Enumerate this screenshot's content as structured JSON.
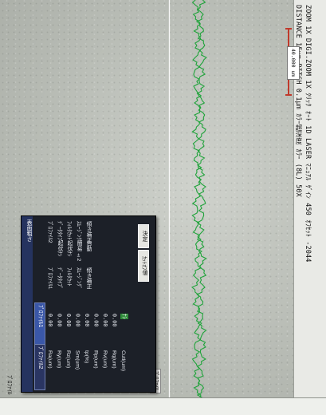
{
  "header": {
    "line1": "ZOOM 1X DIGI.ZOOM 1X ｸﾘｯｸ ｵｰﾄ   1D LASER ﾏﾆｭｱﾙ ｹﾞｲﾝ 450 ｵﾌｾｯﾄ -2044",
    "line2": "DISTANCE 15μm PITCH 0.1μm ｶﾗｰ超深度 ｶﾗｰ (8L) 50X"
  },
  "scale_label": "40.000 um",
  "status": {
    "cursor_label": "ﾌﾟﾛﾌｧｲﾙ",
    "bottom_label": "ﾌﾟﾛﾌｧｲﾙ"
  },
  "panel": {
    "title": "表面粗さ",
    "tabs": [
      "ﾌﾟﾛﾌｧｲﾙ1",
      "ﾌﾟﾛﾌｧｲﾙ2"
    ],
    "params": [
      {
        "name": "Ra(um)",
        "value": "0.00"
      },
      {
        "name": "Ry(um)",
        "value": "0.00"
      },
      {
        "name": "Rz(um)",
        "value": "0.00"
      },
      {
        "name": "Sm(um)",
        "value": "0.00"
      },
      {
        "name": "tp(%)",
        "value": "0.00"
      },
      {
        "name": "Rp(um)",
        "value": "0.00"
      },
      {
        "name": "Rv(um)",
        "value": "0.00"
      },
      {
        "name": "Rq(um)",
        "value": "0.00"
      },
      {
        "name": "Cutl(um)",
        "value": "ﾅｼ"
      }
    ],
    "settings_group_1": [
      {
        "name": "ﾌﾟﾛﾌｧｲﾙ1",
        "value": ""
      },
      {
        "name": "ﾃﾞｰﾀﾀｲﾌﾟ",
        "value": "起伏ﾅｼ"
      },
      {
        "name": "ﾌｨﾙﾀｶｯﾄ",
        "value": "起伏ﾅｼ"
      },
      {
        "name": "ｽﾑｰｼﾞﾝｸﾞ",
        "value": "簡易 ±2"
      },
      {
        "name": "傾き補正",
        "value": "自動"
      }
    ],
    "settings_group_2": [
      {
        "name": "ﾌﾟﾛﾌｧｲﾙ2",
        "value": ""
      },
      {
        "name": "ﾃﾞｰﾀﾀｲﾌﾟ",
        "value": "起伏ﾅｼ"
      },
      {
        "name": "ﾌｨﾙﾀｶｯﾄ",
        "value": "起伏ﾅｼ"
      },
      {
        "name": "ｽﾑｰｼﾞﾝｸﾞ",
        "value": "簡易 ±2"
      },
      {
        "name": "傾き補正",
        "value": "起伏ﾅｼ"
      }
    ],
    "buttons": {
      "cutoff": "ｶｯﾄｵﾌ値",
      "ok": "決定"
    }
  },
  "colors": {
    "profile": "#1fa33a",
    "scale": "#c0392b",
    "panel_bg": "#1c2028",
    "panel_title": "#25335f",
    "highlight": "#2f9a3f"
  }
}
